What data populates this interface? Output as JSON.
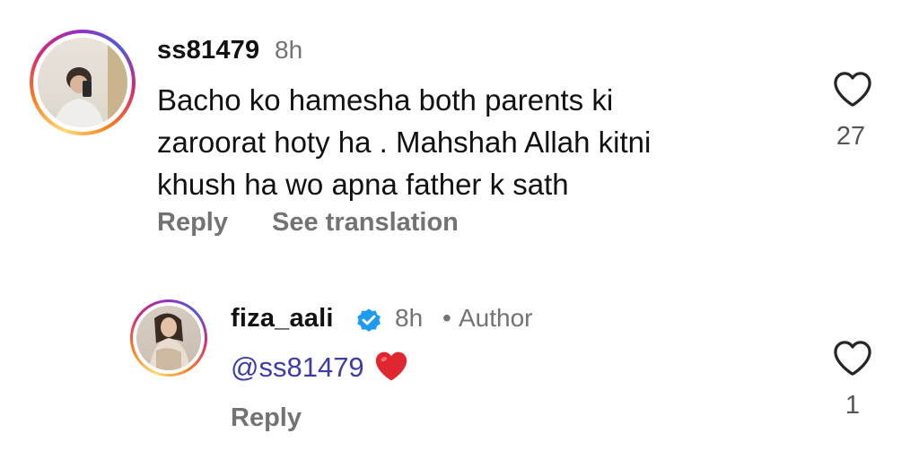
{
  "comments": [
    {
      "username": "ss81479",
      "time": "8h",
      "text": "Bacho ko hamesha both parents ki zaroorat hoty ha . Mahshah Allah kitni khush ha wo apna father k sath",
      "text_lines": [
        "Bacho ko hamesha both parents ki",
        "zaroorat hoty ha . Mahshah Allah kitni",
        "khush ha wo apna father k sath"
      ],
      "reply_label": "Reply",
      "translate_label": "See translation",
      "like_count": "27"
    },
    {
      "username": "fiza_aali",
      "verified": true,
      "time": "8h",
      "separator": "•",
      "author_label": "Author",
      "mention": "@ss81479",
      "emoji": "❤️",
      "reply_label": "Reply",
      "like_count": "1"
    }
  ],
  "colors": {
    "secondary_text": "#737373",
    "mention": "#3e3da8",
    "verified_badge": "#1d9bf0",
    "heart_emoji": "#e0262f"
  },
  "icons": [
    "heart-outline-icon",
    "verified-badge-icon",
    "heart-emoji-icon"
  ]
}
